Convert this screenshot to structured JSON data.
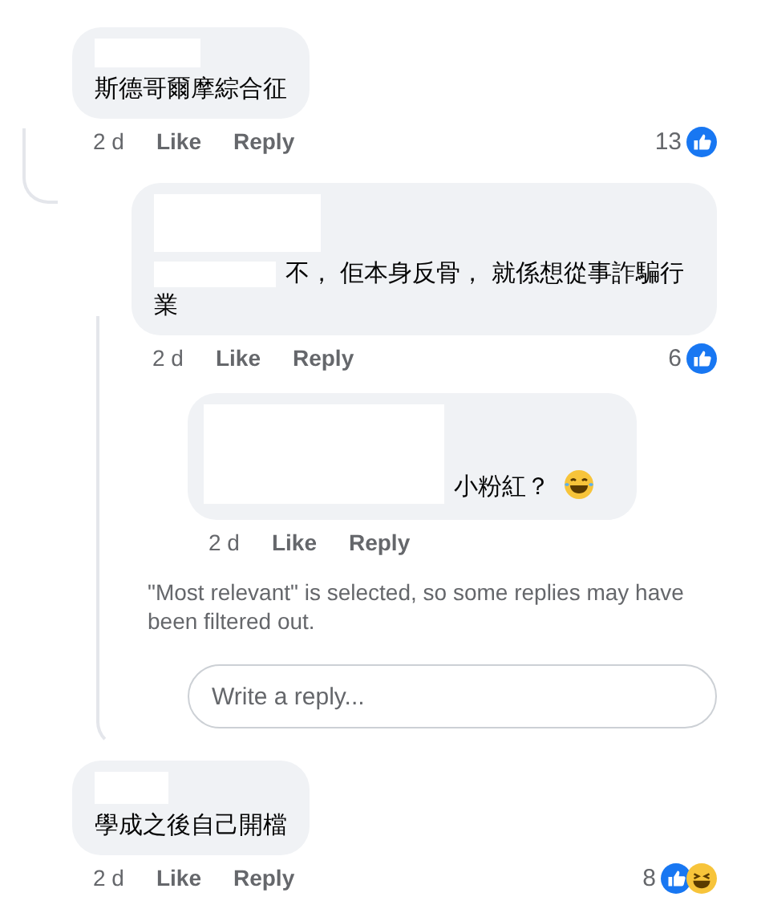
{
  "comments": [
    {
      "text": "斯德哥爾摩綜合征",
      "time": "2 d",
      "like": "Like",
      "reply": "Reply",
      "count": "13",
      "reactions": [
        {
          "kind": "like"
        }
      ],
      "replies": [
        {
          "text": "不， 佢本身反骨， 就係想從事詐騙行業",
          "time": "2 d",
          "like": "Like",
          "reply": "Reply",
          "count": "6",
          "reactions": [
            {
              "kind": "like"
            }
          ],
          "replies": [
            {
              "text": "小粉紅？",
              "end_icon": {
                "kind": "tears_of_joy"
              },
              "time": "2 d",
              "like": "Like",
              "reply": "Reply"
            }
          ],
          "notice": "\"Most relevant\" is selected, so some replies may have been filtered out.",
          "reply_field": {
            "placeholder": "Write a reply..."
          }
        }
      ]
    },
    {
      "text": "學成之後自己開檔",
      "time": "2 d",
      "like": "Like",
      "reply": "Reply",
      "count": "8",
      "reactions": [
        {
          "kind": "like"
        },
        {
          "kind": "haha"
        }
      ]
    }
  ]
}
